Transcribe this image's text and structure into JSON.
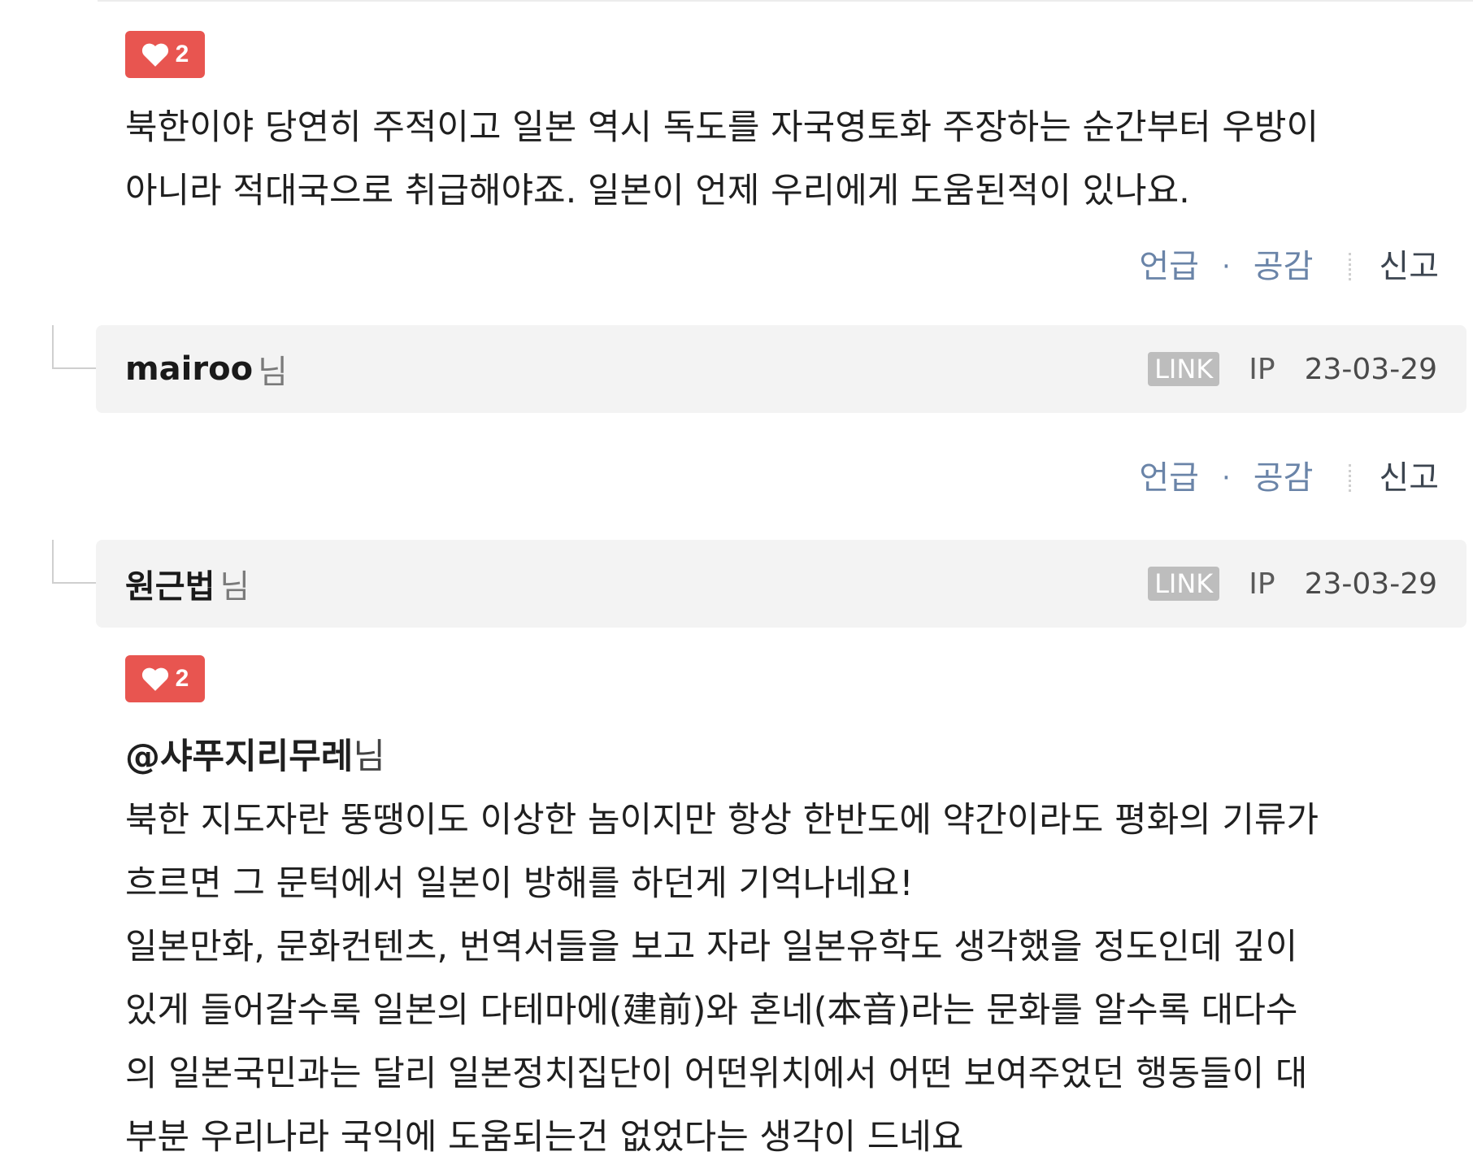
{
  "comments": [
    {
      "likes": "2",
      "lines": [
        "북한이야 당연히 주적이고 일본 역시 독도를 자국영토화 주장하는 순간부터 우방이",
        "아니라 적대국으로 취급해야죠. 일본이 언제 우리에게 도움된적이 있나요."
      ]
    },
    {
      "likes": "2",
      "mention": "@샤푸지리무레",
      "mention_suffix": "님",
      "lines": [
        "북한 지도자란 뚱땡이도 이상한 놈이지만 항상 한반도에 약간이라도 평화의 기류가",
        "흐르면 그 문턱에서 일본이 방해를 하던게 기억나네요!",
        "일본만화, 문화컨텐츠, 번역서들을 보고 자라 일본유학도 생각했을 정도인데 깊이",
        "있게 들어갈수록 일본의 다테마에(建前)와 혼네(本音)라는 문화를 알수록 대다수",
        "의 일본국민과는 달리 일본정치집단이 어떤위치에서 어떤 보여주었던 행동들이 대",
        "부분 우리나라 국익에 도움되는건 없었다는 생각이 드네요"
      ]
    }
  ],
  "actions": {
    "mention": "언급",
    "dot": "·",
    "like": "공감",
    "report": "신고"
  },
  "replies": [
    {
      "author": "mairoo",
      "suffix": "님",
      "link": "LINK",
      "ip": "IP",
      "date": "23-03-29"
    },
    {
      "author": "원근법",
      "suffix": "님",
      "link": "LINK",
      "ip": "IP",
      "date": "23-03-29"
    }
  ],
  "colors": {
    "like_badge": "#e85550",
    "action_link": "#6a84a8",
    "reply_bg": "#f3f3f3"
  },
  "icons": {
    "like": "heart-icon"
  }
}
